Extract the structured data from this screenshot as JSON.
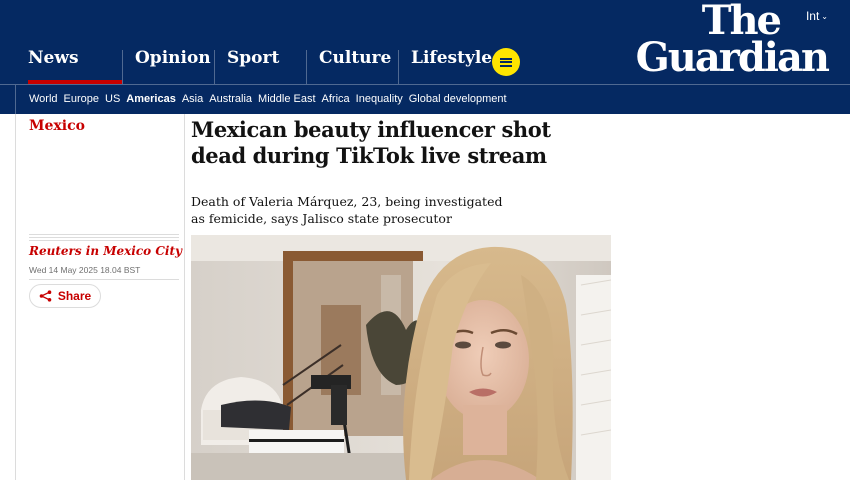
{
  "header": {
    "edition": "Int",
    "logo_line1": "The",
    "logo_line2": "Guardian",
    "pillars": [
      {
        "label": "News"
      },
      {
        "label": "Opinion"
      },
      {
        "label": "Sport"
      },
      {
        "label": "Culture"
      },
      {
        "label": "Lifestyle"
      }
    ],
    "active_pillar": "News",
    "menu_icon": "hamburger-menu-icon",
    "subnav": [
      "World",
      "Europe",
      "US",
      "Americas",
      "Asia",
      "Australia",
      "Middle East",
      "Africa",
      "Inequality",
      "Global development"
    ],
    "subnav_current": "Americas"
  },
  "article": {
    "section": "Mexico",
    "headline": "Mexican beauty influencer shot dead during TikTok live stream",
    "standfirst": "Death of Valeria Márquez, 23, being investigated as femicide, says Jalisco state prosecutor",
    "byline": "Reuters in Mexico City",
    "date": "Wed 14 May 2025 18.04 BST",
    "share_label": "Share"
  },
  "colors": {
    "brand_blue": "#052962",
    "news_red": "#c70000",
    "menu_yellow": "#ffe500",
    "divider": "#dcdcdc"
  }
}
